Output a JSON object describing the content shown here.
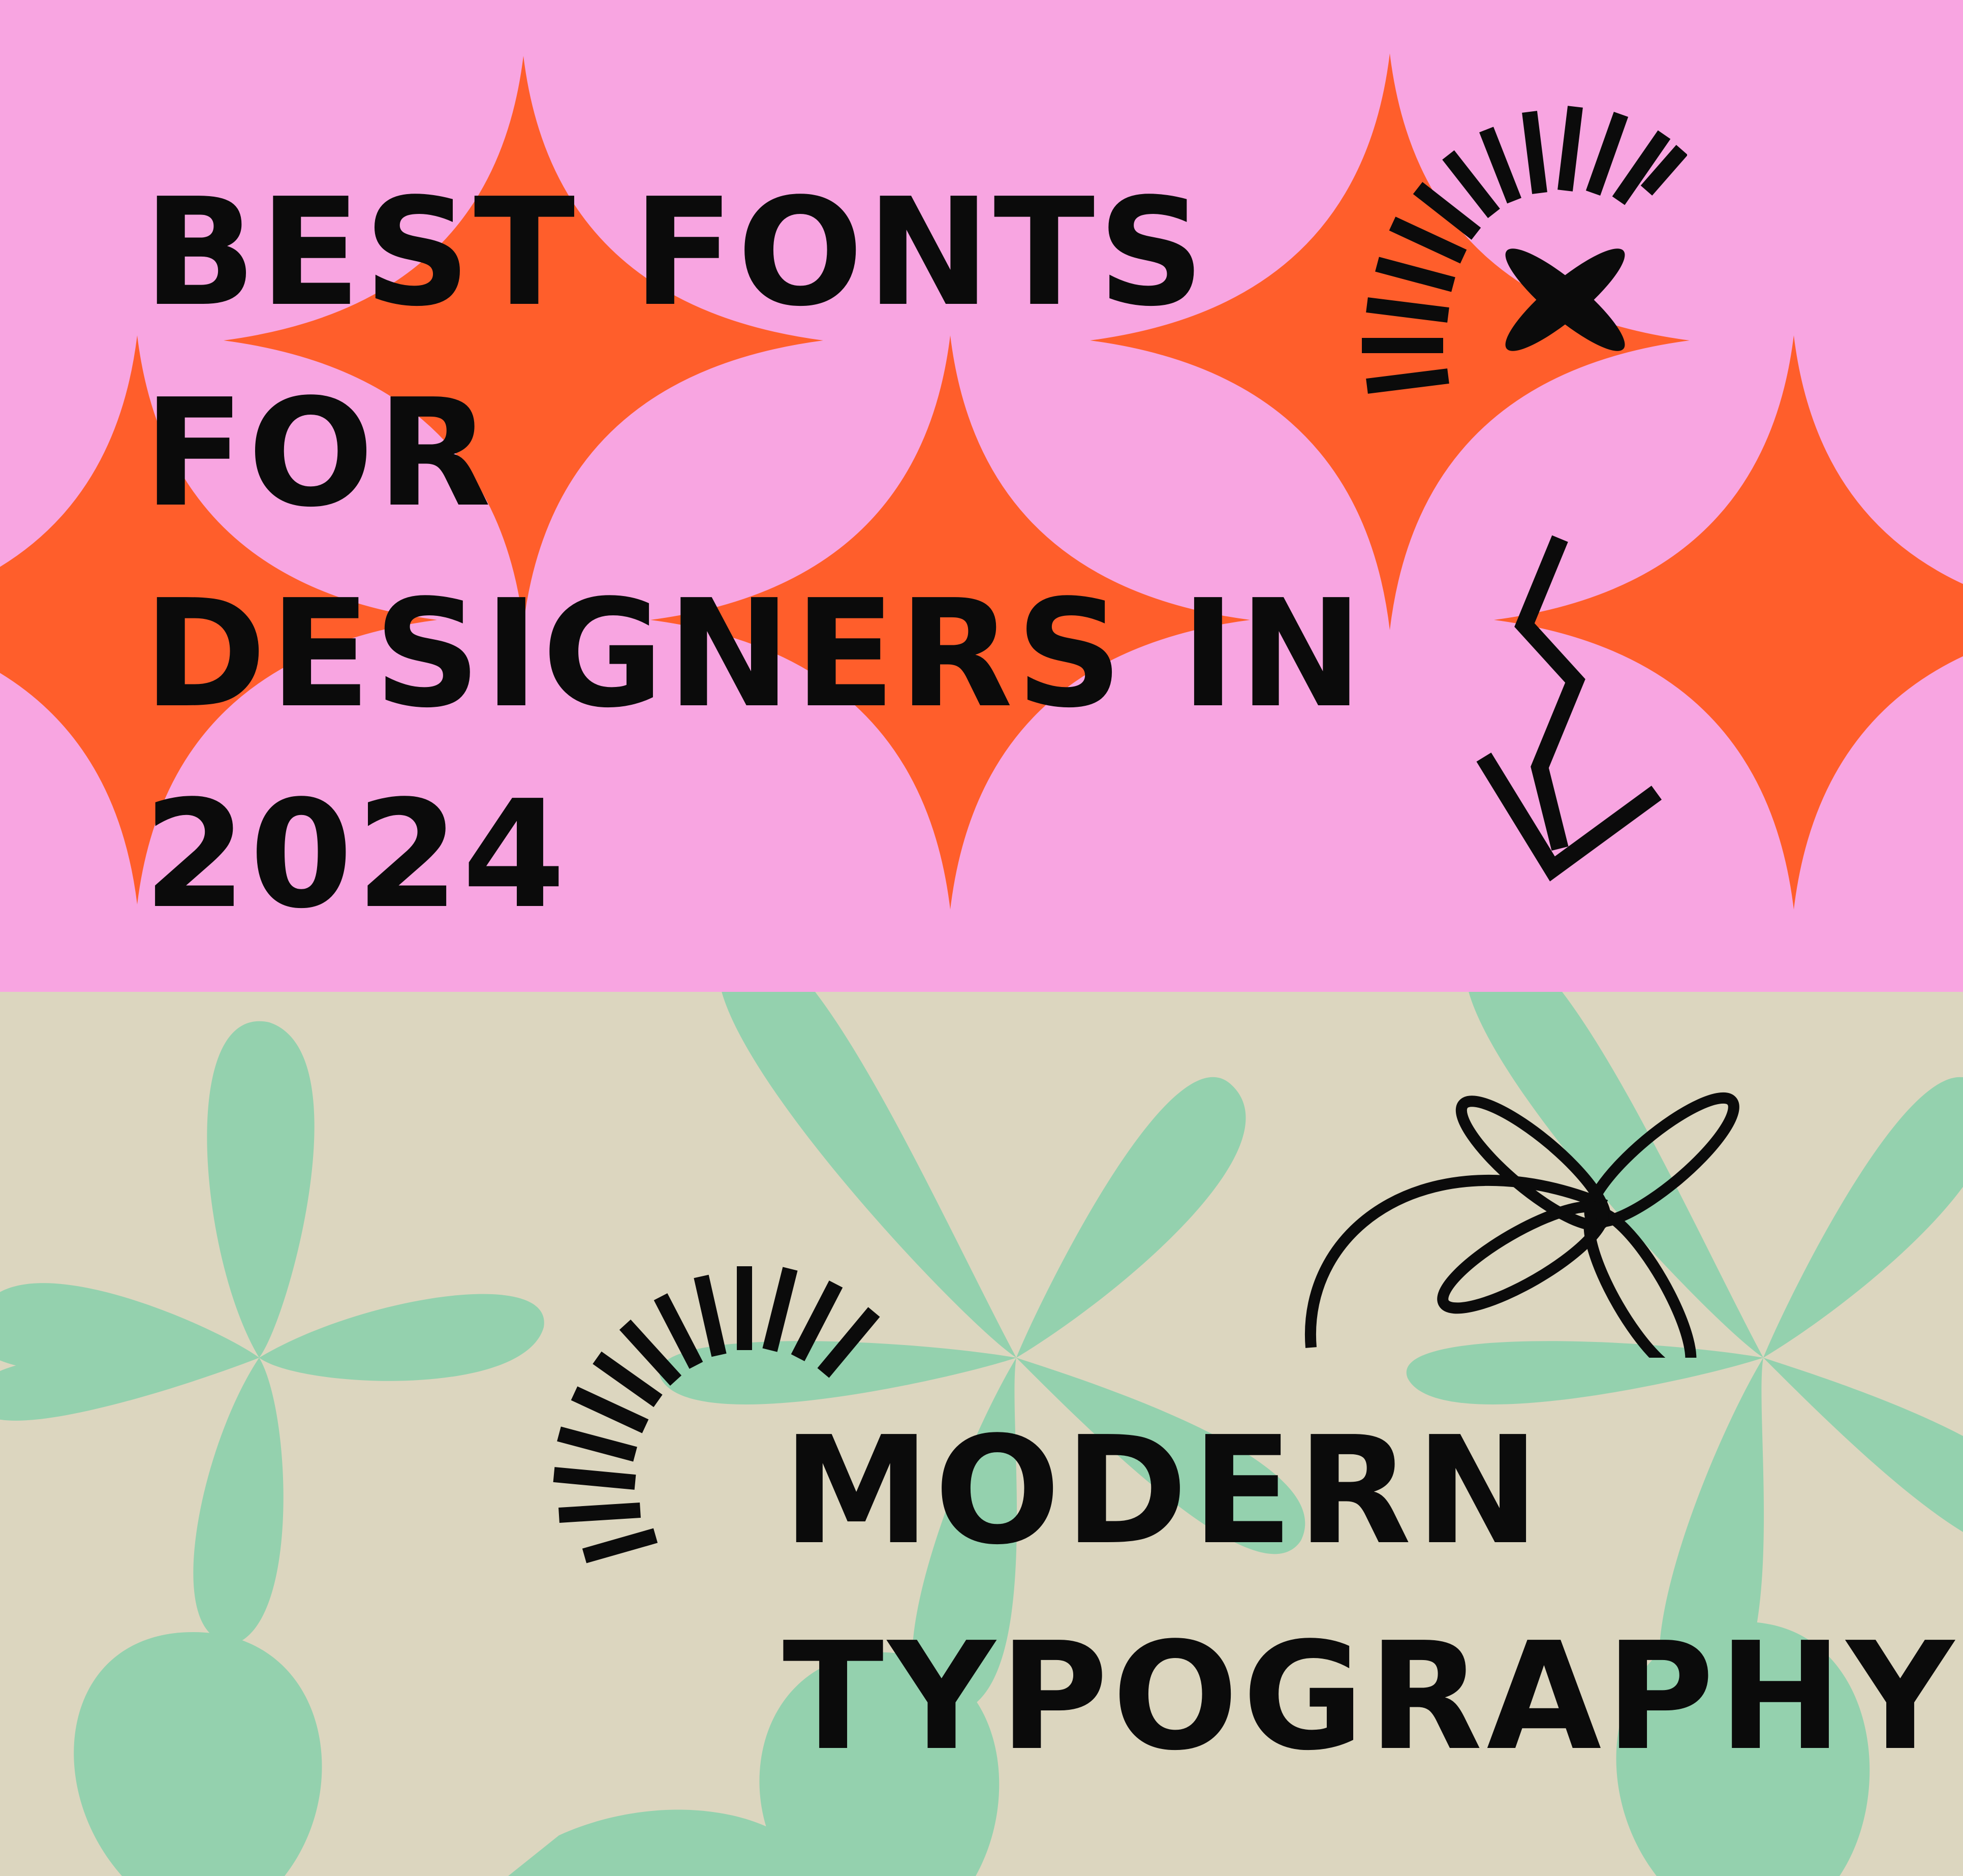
{
  "colors": {
    "pink_background": "#f8a5e1",
    "orange_sparkle": "#ff5e2b",
    "beige_background": "#dcd6bf",
    "mint_petal": "#94d1ae",
    "ink": "#0b0b0b"
  },
  "top_panel": {
    "headline_lines": [
      "BEST FONTS",
      "FOR",
      "DESIGNERS IN",
      "2024"
    ],
    "decorations": [
      "sunburst-icon",
      "flower-icon",
      "zigzag-arrow-icon"
    ]
  },
  "bottom_panel": {
    "headline_lines": [
      "MODERN",
      "TYPOGRAPHY"
    ],
    "decorations": [
      "sunburst-icon",
      "flower-stem-icon"
    ]
  }
}
